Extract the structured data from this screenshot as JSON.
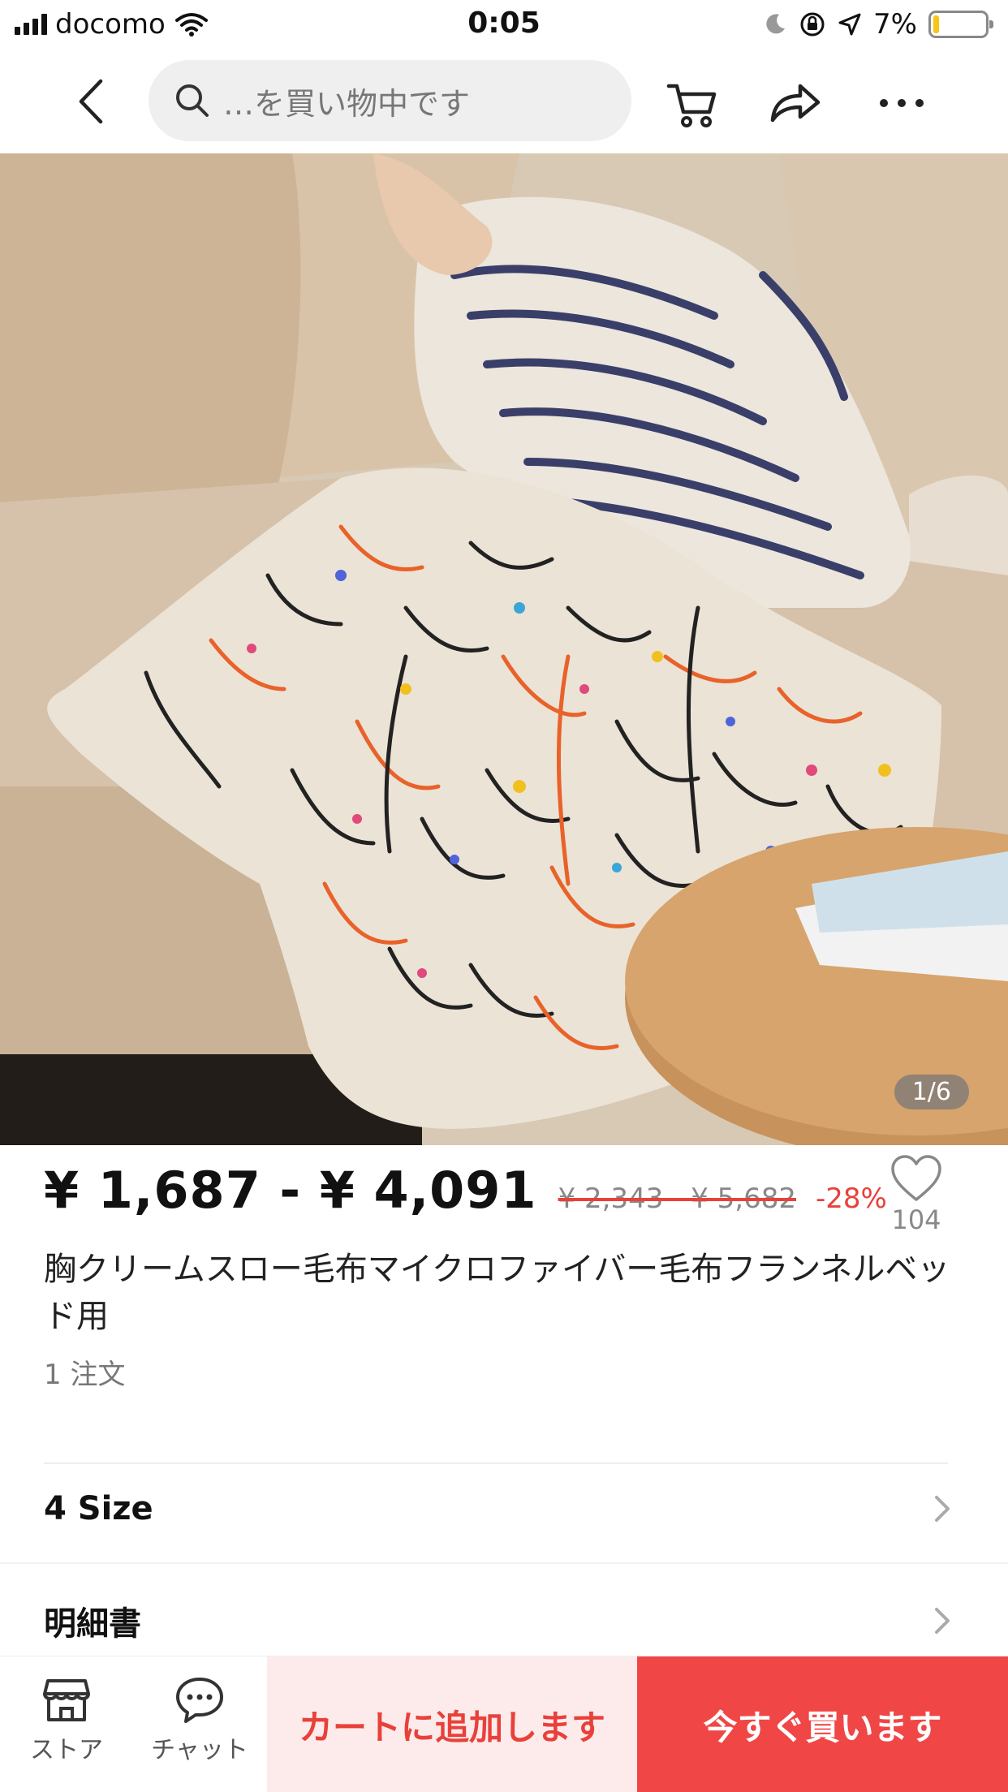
{
  "status_bar": {
    "carrier": "docomo",
    "time": "0:05",
    "battery_percent": "7%",
    "battery_level": 0.07,
    "icons": [
      "signal-icon",
      "wifi-icon",
      "moon-icon",
      "orientation-lock-icon",
      "location-arrow-icon",
      "battery-icon"
    ]
  },
  "nav": {
    "search_placeholder": "…を買い物中です",
    "icons": [
      "back-chevron-icon",
      "search-icon",
      "cart-icon",
      "share-icon",
      "more-icon"
    ]
  },
  "gallery": {
    "counter": "1/6",
    "image_description_icon": "product-photo"
  },
  "product": {
    "price": "¥ 1,687 - ¥ 4,091",
    "original_price": "¥ 2,343 - ¥ 5,682",
    "discount": "-28%",
    "wishlist_count": "104",
    "title": "胸クリームスロー毛布マイクロファイバー毛布フランネルベッド用",
    "orders": "1 注文"
  },
  "options": {
    "size_label": "4 Size",
    "spec_label": "明細書"
  },
  "bottom_bar": {
    "store_label": "ストア",
    "chat_label": "チャット",
    "add_to_cart": "カートに追加します",
    "buy_now": "今すぐ買います"
  },
  "colors": {
    "accent_red": "#f04646",
    "accent_red_light": "#fdebeb",
    "discount_red": "#e8413a"
  }
}
